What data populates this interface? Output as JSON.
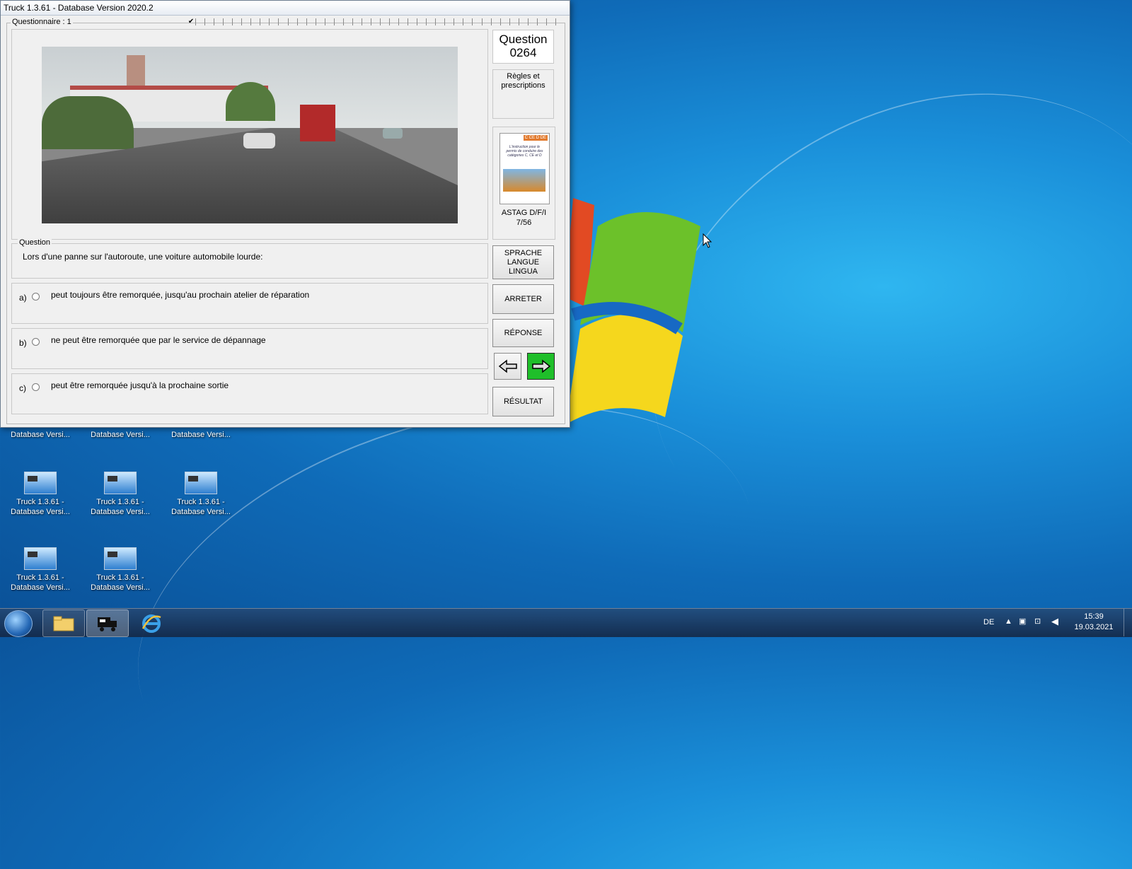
{
  "window": {
    "title": "Truck 1.3.61 - Database Version 2020.2",
    "questionnaire_label": "Questionnaire : 1",
    "current_mark": "✔"
  },
  "question_panel": {
    "number_label": "Question",
    "number": "0264",
    "category": "Règles et prescriptions",
    "book_title": "ASTAG D/F/I",
    "book_ref": "7/56",
    "book_cover_lines": [
      "C CE D DE",
      "L'instruction pour le permis de conduire des catégories C, CE et D"
    ]
  },
  "question": {
    "legend": "Question",
    "text": "Lors d'une panne sur l'autoroute, une voiture automobile lourde:"
  },
  "answers": [
    {
      "letter": "a)",
      "text": "peut toujours être remorquée, jusqu'au prochain atelier de réparation"
    },
    {
      "letter": "b)",
      "text": "ne peut être remorquée que par le service de dépannage"
    },
    {
      "letter": "c)",
      "text": "peut être remorquée jusqu'à la prochaine sortie"
    }
  ],
  "buttons": {
    "language_lines": [
      "SPRACHE",
      "LANGUE",
      "LINGUA"
    ],
    "stop": "ARRETER",
    "answer": "RÉPONSE",
    "result": "RÉSULTAT"
  },
  "desktop_icons": [
    {
      "line1": "",
      "line2": "Database Versi..."
    },
    {
      "line1": "",
      "line2": "Database Versi..."
    },
    {
      "line1": "",
      "line2": "Database Versi..."
    },
    {
      "line1": "Truck 1.3.61 -",
      "line2": "Database Versi..."
    },
    {
      "line1": "Truck 1.3.61 -",
      "line2": "Database Versi..."
    },
    {
      "line1": "Truck 1.3.61 -",
      "line2": "Database Versi..."
    },
    {
      "line1": "Truck 1.3.61 -",
      "line2": "Database Versi..."
    },
    {
      "line1": "Truck 1.3.61 -",
      "line2": "Database Versi..."
    }
  ],
  "taskbar": {
    "language": "DE",
    "time": "15:39",
    "date": "19.03.2021"
  },
  "colors": {
    "next_button": "#1fbf2a",
    "accent_blue": "#1a8fd9"
  }
}
